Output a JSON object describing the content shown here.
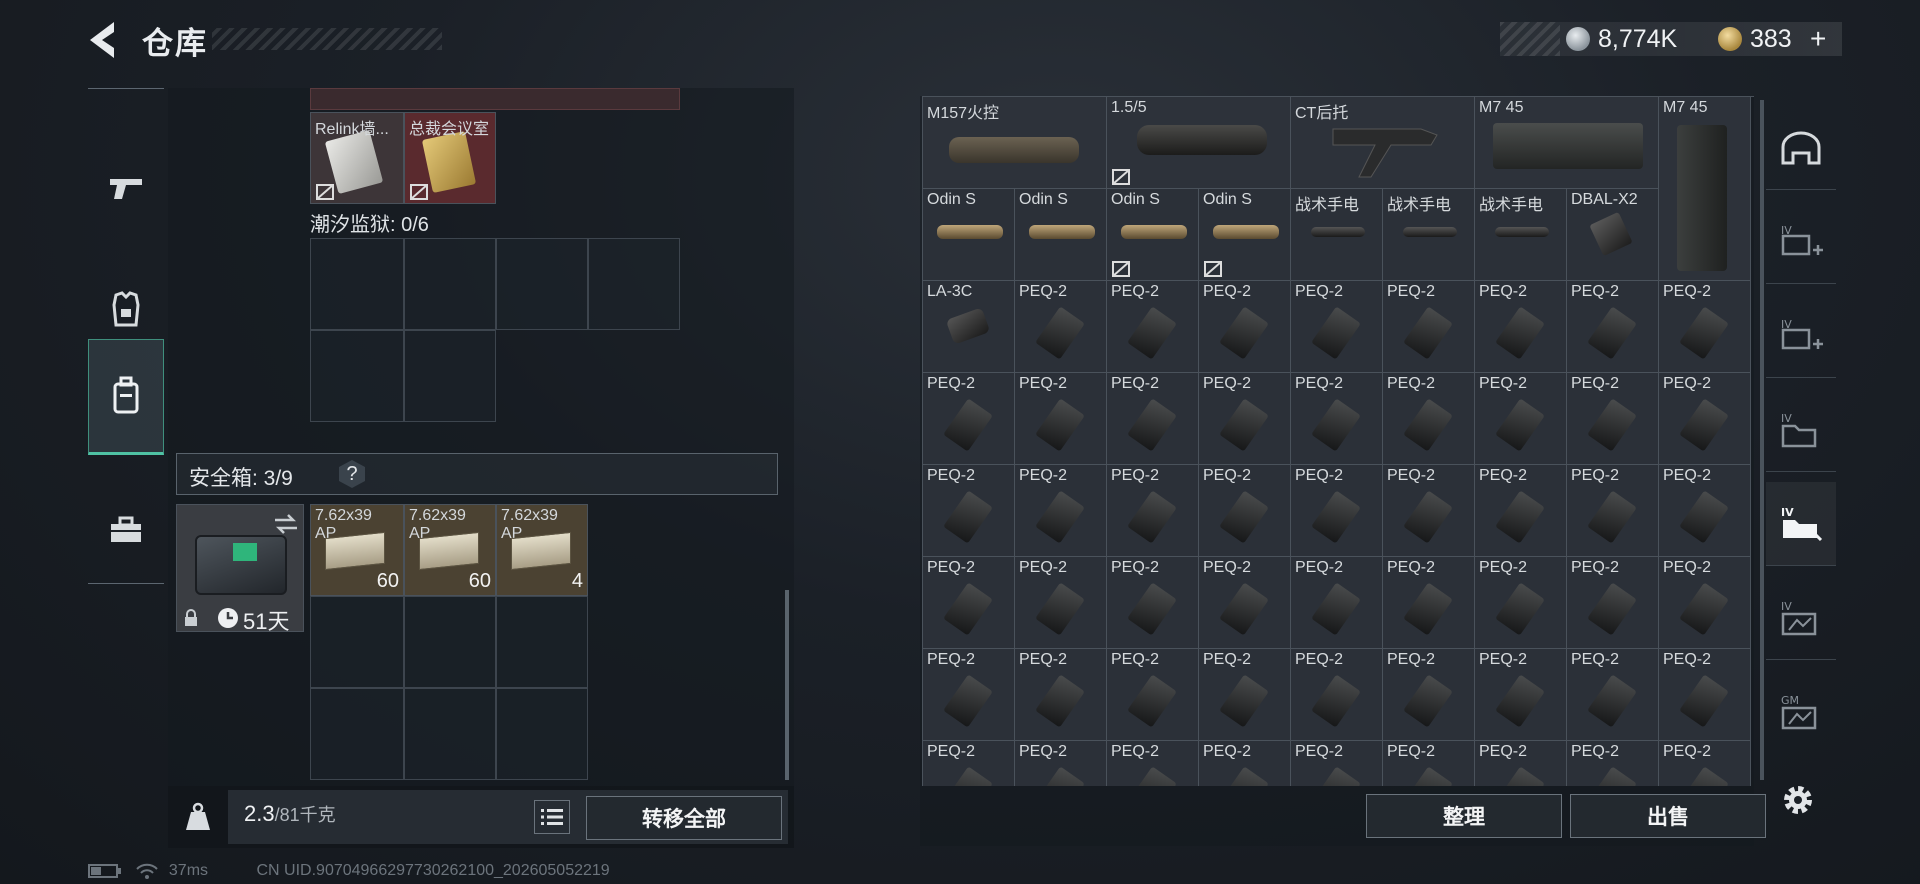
{
  "header": {
    "title": "仓库",
    "currency_silver": "8,774K",
    "currency_gold": "383",
    "add_label": "+"
  },
  "left_rail": {
    "items": [
      "pistol-icon",
      "armor-icon",
      "backpack-icon",
      "toolbox-icon"
    ],
    "active_index": 2
  },
  "left_panel": {
    "key_items": [
      {
        "label": "Relink墙..."
      },
      {
        "label": "总裁会议室"
      }
    ],
    "prison_label": "潮汐监狱: 0/6",
    "safebox_label": "安全箱: 3/9",
    "help_label": "?",
    "safebox_item": {
      "duration": "51天"
    },
    "ammo": [
      {
        "label": "7.62x39",
        "sub": "AP",
        "count": "60"
      },
      {
        "label": "7.62x39",
        "sub": "AP",
        "count": "60"
      },
      {
        "label": "7.62x39",
        "sub": "AP",
        "count": "4"
      }
    ],
    "weight_value": "2.3",
    "weight_unit": "/81千克",
    "transfer_all": "转移全部"
  },
  "warehouse": {
    "top_items": [
      {
        "label": "M157火控",
        "cols": 2
      },
      {
        "label": "1.5/5",
        "cols": 2
      },
      {
        "label": "CT后托",
        "cols": 2
      },
      {
        "label": "M7 45",
        "cols": 2
      },
      {
        "label": "M7 45",
        "cols": 1
      }
    ],
    "row2": [
      "Odin S",
      "Odin S",
      "Odin S",
      "Odin S",
      "战术手电",
      "战术手电",
      "战术手电",
      "DBAL-X2"
    ],
    "row3": [
      "LA-3C",
      "PEQ-2",
      "PEQ-2",
      "PEQ-2",
      "PEQ-2",
      "PEQ-2",
      "PEQ-2",
      "PEQ-2",
      "PEQ-2"
    ],
    "peq_label": "PEQ-2",
    "sort_label": "整理",
    "sell_label": "出售"
  },
  "right_rail": {
    "items": [
      "shelter-icon",
      "ammo-crate-add-icon",
      "ammo-crate-add-icon-2",
      "folder-stack-icon",
      "folder-stack-active-icon",
      "chart-folder-icon",
      "gm-folder-icon"
    ],
    "active_index": 4
  },
  "status": {
    "ping": "37ms",
    "uid": "CN UID.907049662977302621​00_202605052219"
  },
  "colors": {
    "accent": "#4fc2a4",
    "no_trade_red": "#7a2a2a",
    "key_tile": "#5a2a2e"
  }
}
